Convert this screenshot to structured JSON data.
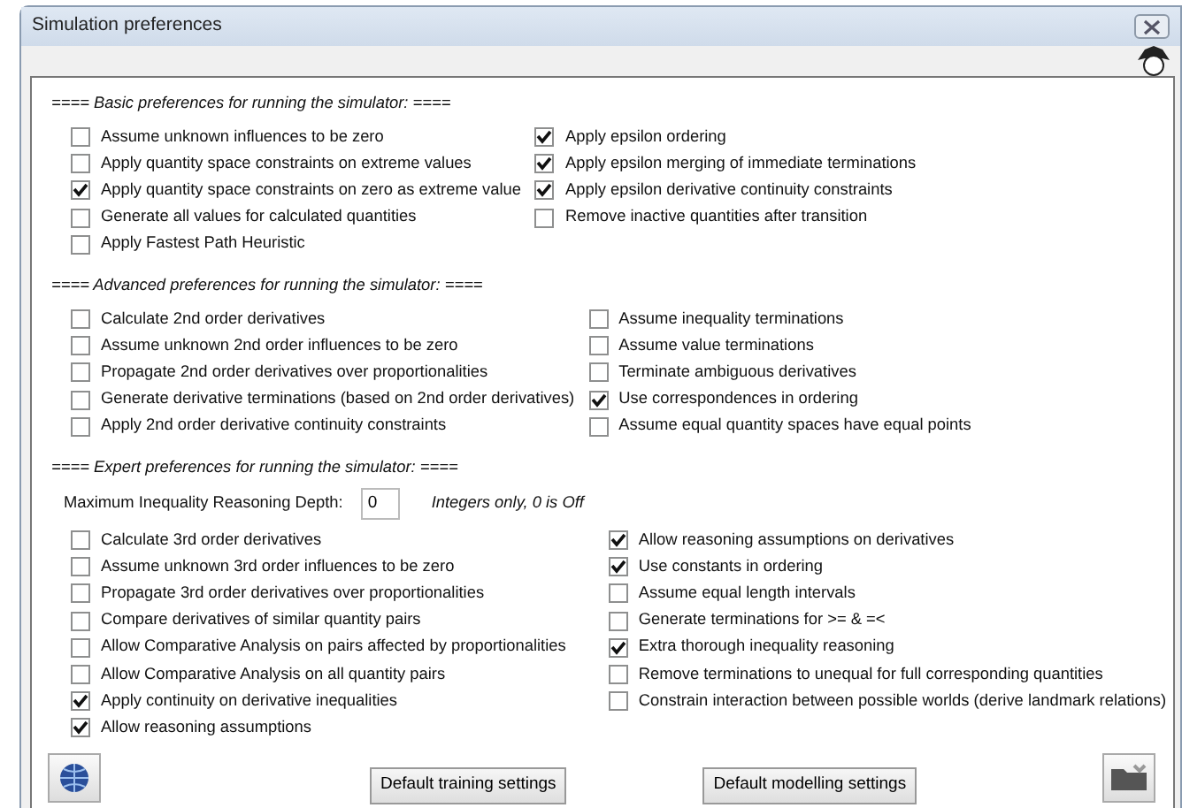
{
  "window": {
    "title": "Simulation preferences"
  },
  "sections": [
    {
      "heading": "==== Basic preferences for running the simulator: ====",
      "left": [
        {
          "label": "Assume unknown influences to be zero",
          "checked": false
        },
        {
          "label": "Apply quantity space constraints on extreme values",
          "checked": false
        },
        {
          "label": "Apply quantity space constraints on zero as extreme value",
          "checked": true
        },
        {
          "label": "Generate all values for calculated quantities",
          "checked": false
        },
        {
          "label": "Apply Fastest Path Heuristic",
          "checked": false
        }
      ],
      "right": [
        {
          "label": "Apply epsilon ordering",
          "checked": true
        },
        {
          "label": "Apply epsilon merging of immediate terminations",
          "checked": true
        },
        {
          "label": "Apply epsilon derivative continuity constraints",
          "checked": true
        },
        {
          "label": "Remove inactive quantities after transition",
          "checked": false
        }
      ]
    },
    {
      "heading": "==== Advanced preferences for running the simulator: ====",
      "left": [
        {
          "label": "Calculate 2nd order derivatives",
          "checked": false
        },
        {
          "label": "Assume unknown 2nd order influences to be zero",
          "checked": false
        },
        {
          "label": "Propagate 2nd order derivatives over proportionalities",
          "checked": false
        },
        {
          "label": "Generate derivative terminations (based on 2nd order derivatives)",
          "checked": false
        },
        {
          "label": "Apply 2nd order derivative continuity constraints",
          "checked": false
        }
      ],
      "right": [
        {
          "label": "Assume inequality terminations",
          "checked": false
        },
        {
          "label": "Assume value terminations",
          "checked": false
        },
        {
          "label": "Terminate ambiguous derivatives",
          "checked": false
        },
        {
          "label": "Use correspondences in ordering",
          "checked": true
        },
        {
          "label": "Assume equal quantity spaces have equal points",
          "checked": false
        }
      ]
    },
    {
      "heading": "==== Expert preferences for running the simulator: ====",
      "depth_field": {
        "label": "Maximum Inequality Reasoning Depth:",
        "value": "0",
        "hint": "Integers only, 0 is Off"
      },
      "left": [
        {
          "label": "Calculate 3rd order derivatives",
          "checked": false
        },
        {
          "label": "Assume unknown 3rd order influences to be zero",
          "checked": false
        },
        {
          "label": "Propagate 3rd order derivatives over proportionalities",
          "checked": false
        },
        {
          "label": "Compare derivatives of similar quantity pairs",
          "checked": false
        },
        {
          "label": "Allow Comparative Analysis on pairs affected by proportionalities",
          "checked": false
        },
        {
          "label": "Allow Comparative Analysis on all quantity pairs",
          "checked": false
        },
        {
          "label": "Apply continuity on derivative inequalities",
          "checked": true
        },
        {
          "label": "Allow reasoning assumptions",
          "checked": true
        }
      ],
      "right": [
        {
          "label": "Allow reasoning assumptions on derivatives",
          "checked": true
        },
        {
          "label": "Use constants in ordering",
          "checked": true
        },
        {
          "label": "Assume equal length intervals",
          "checked": false
        },
        {
          "label": "Generate terminations for >= & =<",
          "checked": false
        },
        {
          "label": "Extra thorough inequality reasoning",
          "checked": true
        },
        {
          "label": "Remove terminations to unequal for full corresponding quantities",
          "checked": false
        },
        {
          "label": "Constrain interaction between possible worlds (derive landmark relations)",
          "checked": false
        }
      ]
    }
  ],
  "buttons": [
    "Default training settings",
    "Default modelling settings"
  ]
}
